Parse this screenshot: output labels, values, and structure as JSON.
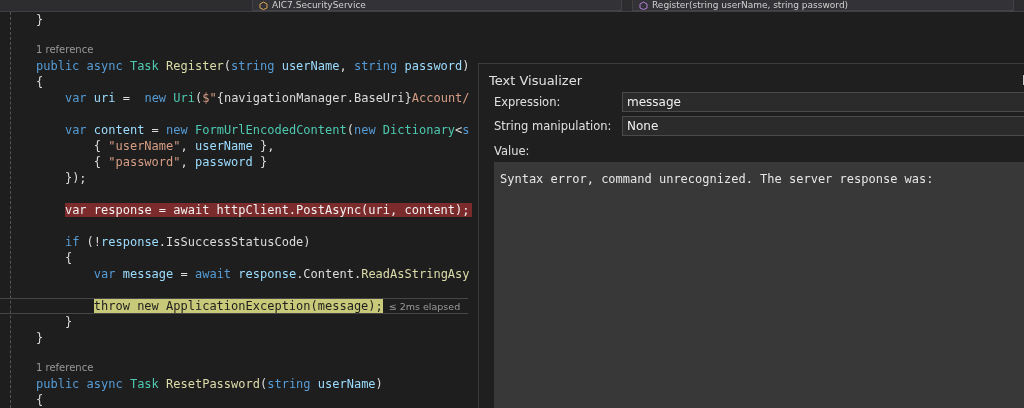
{
  "navigation_bar": {
    "dropdowns": [
      {
        "label": "AIC7.SecurityService"
      },
      {
        "label": "Register(string userName, string password)"
      }
    ]
  },
  "editor": {
    "lines": [
      {
        "kind": "code",
        "tokens": [
          {
            "kind": "plain",
            "text": "}"
          }
        ]
      },
      {
        "kind": "blank"
      },
      {
        "kind": "codelens",
        "text": "1 reference"
      },
      {
        "kind": "code",
        "tokens": [
          {
            "kind": "kw",
            "text": "public async "
          },
          {
            "kind": "type",
            "text": "Task "
          },
          {
            "kind": "method",
            "text": "Register"
          },
          {
            "kind": "plain",
            "text": "("
          },
          {
            "kind": "kw",
            "text": "string "
          },
          {
            "kind": "param",
            "text": "userName"
          },
          {
            "kind": "plain",
            "text": ", "
          },
          {
            "kind": "kw",
            "text": "string "
          },
          {
            "kind": "param",
            "text": "password"
          },
          {
            "kind": "plain",
            "text": ")"
          }
        ]
      },
      {
        "kind": "code",
        "tokens": [
          {
            "kind": "plain",
            "text": "{"
          }
        ]
      },
      {
        "kind": "code",
        "tokens": [
          {
            "kind": "kw",
            "text": "    var "
          },
          {
            "kind": "param",
            "text": "uri"
          },
          {
            "kind": "plain",
            "text": " =  "
          },
          {
            "kind": "kw",
            "text": "new "
          },
          {
            "kind": "type",
            "text": "Uri"
          },
          {
            "kind": "plain",
            "text": "("
          },
          {
            "kind": "str",
            "text": "$\""
          },
          {
            "kind": "plain",
            "text": "{navigationManager.BaseUri}"
          },
          {
            "kind": "str",
            "text": "Account/"
          }
        ]
      },
      {
        "kind": "blank"
      },
      {
        "kind": "code",
        "tokens": [
          {
            "kind": "kw",
            "text": "    var "
          },
          {
            "kind": "param",
            "text": "content"
          },
          {
            "kind": "plain",
            "text": " = "
          },
          {
            "kind": "kw",
            "text": "new "
          },
          {
            "kind": "type",
            "text": "FormUrlEncodedContent"
          },
          {
            "kind": "plain",
            "text": "("
          },
          {
            "kind": "kw",
            "text": "new "
          },
          {
            "kind": "type",
            "text": "Dictionary"
          },
          {
            "kind": "plain",
            "text": "<"
          },
          {
            "kind": "kw",
            "text": "s"
          }
        ]
      },
      {
        "kind": "code",
        "tokens": [
          {
            "kind": "plain",
            "text": "        { "
          },
          {
            "kind": "str",
            "text": "\"userName\""
          },
          {
            "kind": "plain",
            "text": ", "
          },
          {
            "kind": "param",
            "text": "userName"
          },
          {
            "kind": "plain",
            "text": " },"
          }
        ]
      },
      {
        "kind": "code",
        "tokens": [
          {
            "kind": "plain",
            "text": "        { "
          },
          {
            "kind": "str",
            "text": "\"password\""
          },
          {
            "kind": "plain",
            "text": ", "
          },
          {
            "kind": "param",
            "text": "password"
          },
          {
            "kind": "plain",
            "text": " }"
          }
        ]
      },
      {
        "kind": "code",
        "tokens": [
          {
            "kind": "plain",
            "text": "    });"
          }
        ]
      },
      {
        "kind": "blank"
      },
      {
        "kind": "breakpoint",
        "tokens": [
          {
            "kind": "plain",
            "text": "    var response = await httpClient.PostAsync(uri, content);"
          }
        ]
      },
      {
        "kind": "blank"
      },
      {
        "kind": "code",
        "tokens": [
          {
            "kind": "kw",
            "text": "    if"
          },
          {
            "kind": "plain",
            "text": " (!"
          },
          {
            "kind": "param",
            "text": "response"
          },
          {
            "kind": "plain",
            "text": ".IsSuccessStatusCode)"
          }
        ]
      },
      {
        "kind": "code",
        "tokens": [
          {
            "kind": "plain",
            "text": "    {"
          }
        ]
      },
      {
        "kind": "code",
        "tokens": [
          {
            "kind": "kw",
            "text": "        var "
          },
          {
            "kind": "param",
            "text": "message"
          },
          {
            "kind": "plain",
            "text": " = "
          },
          {
            "kind": "kw",
            "text": "await "
          },
          {
            "kind": "param",
            "text": "response"
          },
          {
            "kind": "plain",
            "text": ".Content."
          },
          {
            "kind": "method",
            "text": "ReadAsStringAsy"
          }
        ]
      },
      {
        "kind": "blank"
      },
      {
        "kind": "current",
        "hint": "≤ 2ms elapsed",
        "tokens": [
          {
            "kind": "plain",
            "text": "        throw new ApplicationException(message);"
          }
        ]
      },
      {
        "kind": "code",
        "tokens": [
          {
            "kind": "plain",
            "text": "    }"
          }
        ]
      },
      {
        "kind": "code",
        "tokens": [
          {
            "kind": "plain",
            "text": "}"
          }
        ]
      },
      {
        "kind": "blank"
      },
      {
        "kind": "codelens",
        "text": "1 reference"
      },
      {
        "kind": "code",
        "tokens": [
          {
            "kind": "kw",
            "text": "public async "
          },
          {
            "kind": "type",
            "text": "Task "
          },
          {
            "kind": "method",
            "text": "ResetPassword"
          },
          {
            "kind": "plain",
            "text": "("
          },
          {
            "kind": "kw",
            "text": "string "
          },
          {
            "kind": "param",
            "text": "userName"
          },
          {
            "kind": "plain",
            "text": ")"
          }
        ]
      },
      {
        "kind": "code",
        "tokens": [
          {
            "kind": "plain",
            "text": "{"
          }
        ]
      }
    ]
  },
  "text_visualizer": {
    "title": "Text Visualizer",
    "expression": {
      "label": "Expression:",
      "value": "message"
    },
    "string_manipulation": {
      "label": "String manipulation:",
      "value": "None"
    },
    "value": {
      "label": "Value:",
      "text": "Syntax error, command unrecognized. The server response was:"
    }
  }
}
